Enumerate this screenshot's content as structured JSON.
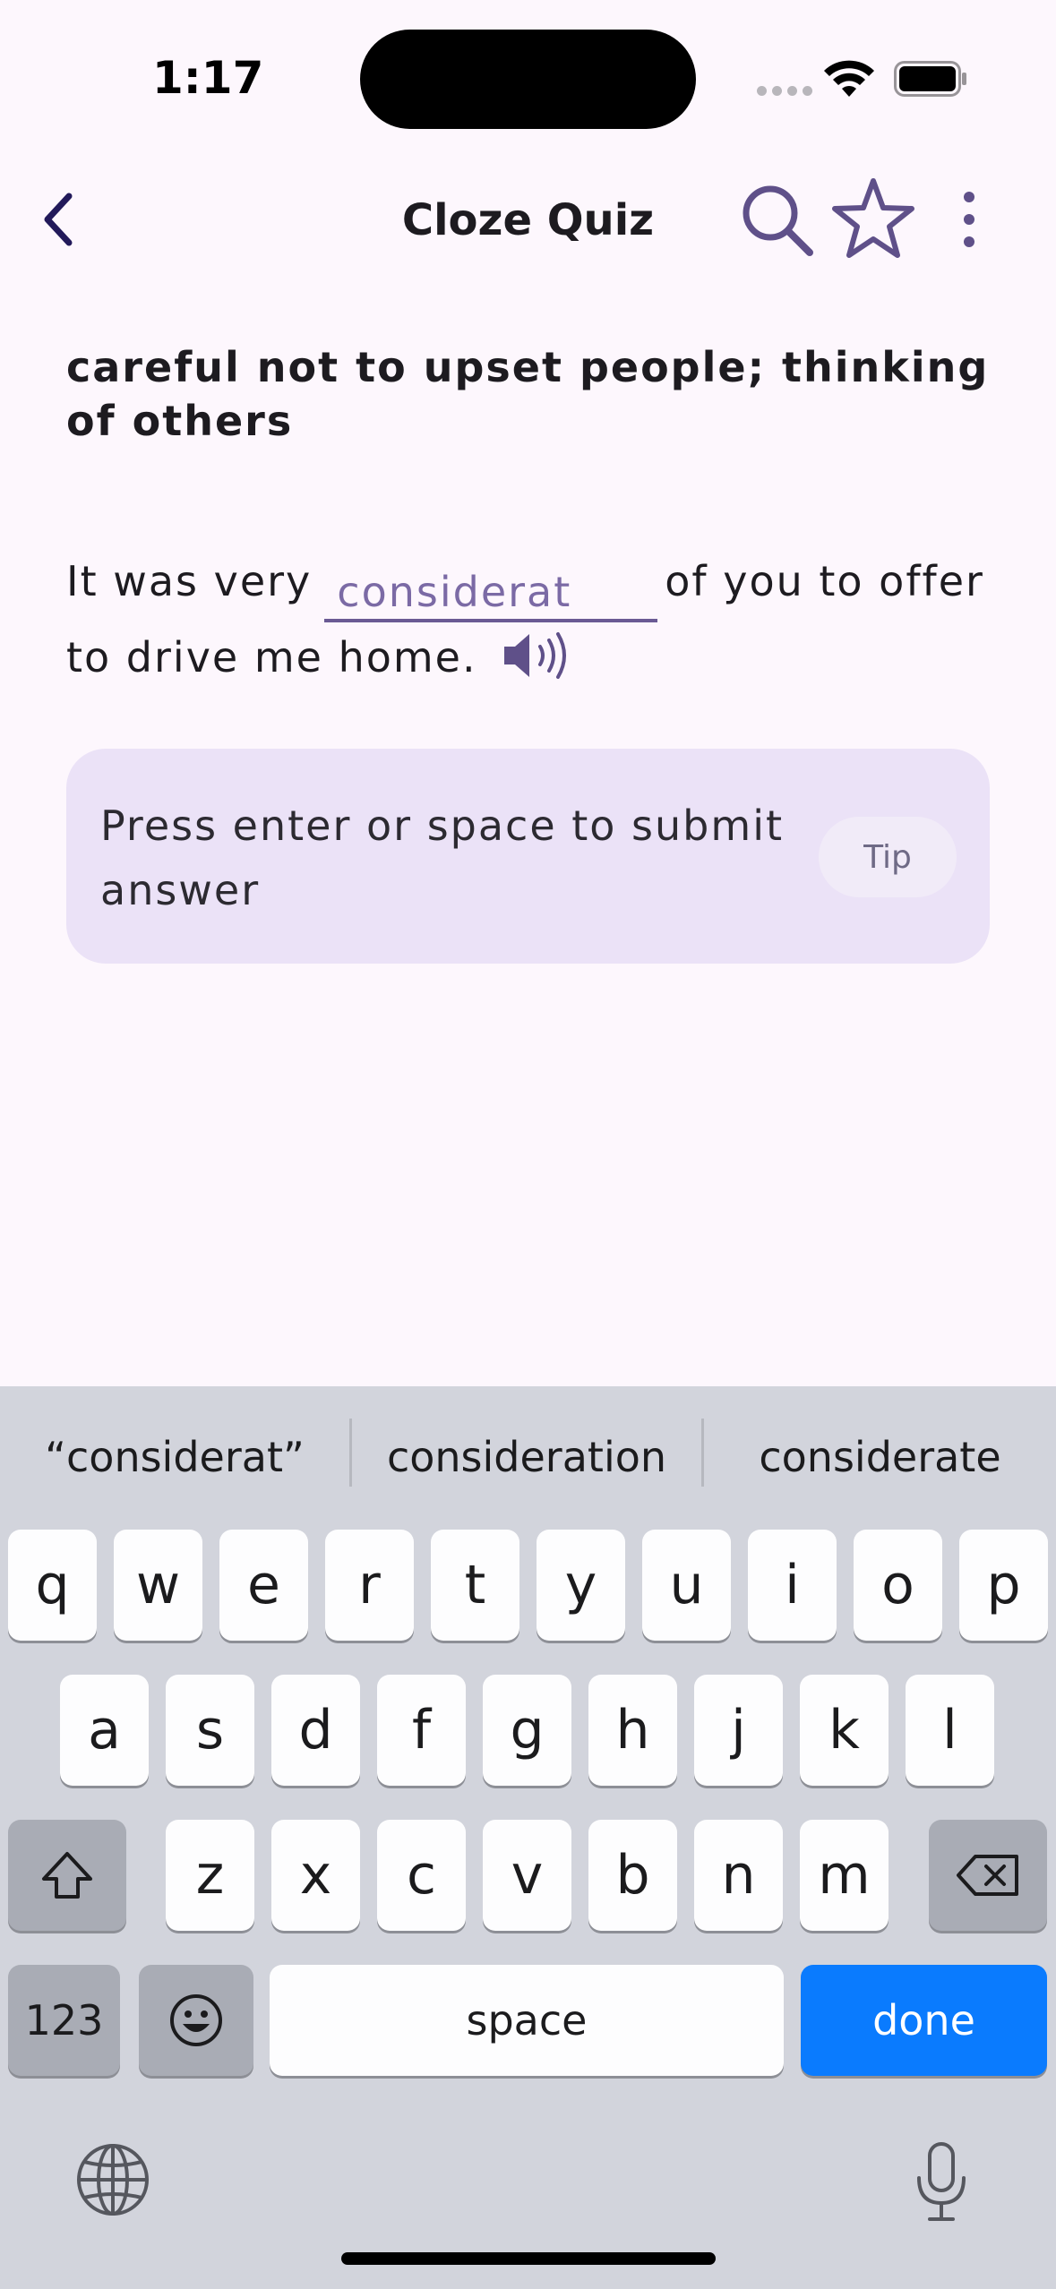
{
  "status": {
    "time": "1:17"
  },
  "app_bar": {
    "title": "Cloze Quiz"
  },
  "quiz": {
    "definition": "careful not to upset people; thinking of others",
    "sentence_before": "It was very",
    "sentence_after_line1": "of you to offer",
    "sentence_after_line2": "to drive me home.",
    "answer_value": "considerat"
  },
  "tip_card": {
    "text": "Press enter or space to submit answer",
    "button_label": "Tip"
  },
  "keyboard": {
    "suggestions": [
      "“considerat”",
      "consideration",
      "considerate"
    ],
    "row1": [
      "q",
      "w",
      "e",
      "r",
      "t",
      "y",
      "u",
      "i",
      "o",
      "p"
    ],
    "row2": [
      "a",
      "s",
      "d",
      "f",
      "g",
      "h",
      "j",
      "k",
      "l"
    ],
    "row3": [
      "z",
      "x",
      "c",
      "v",
      "b",
      "n",
      "m"
    ],
    "numbers_label": "123",
    "space_label": "space",
    "done_label": "done",
    "accent_color": "#0a7bfe"
  },
  "colors": {
    "background": "#fdf7fd",
    "primary": "#6a5a94",
    "tip_card": "#ebe2f7"
  }
}
